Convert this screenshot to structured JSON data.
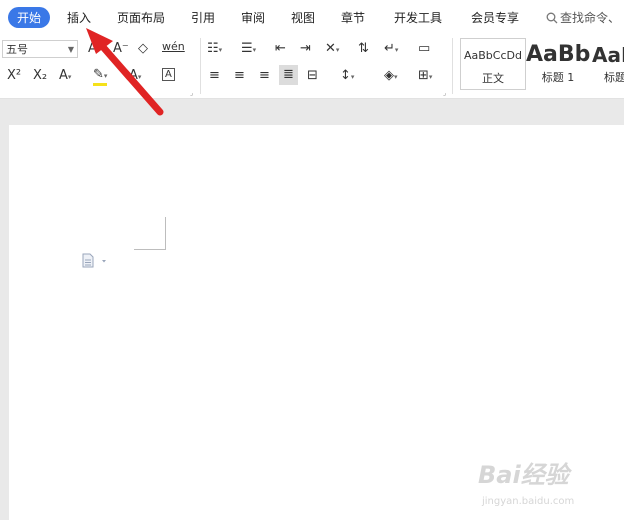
{
  "tabs": [
    {
      "label": "开始",
      "active": true
    },
    {
      "label": "插入"
    },
    {
      "label": "页面布局"
    },
    {
      "label": "引用"
    },
    {
      "label": "审阅"
    },
    {
      "label": "视图"
    },
    {
      "label": "章节"
    },
    {
      "label": "开发工具"
    },
    {
      "label": "会员专享"
    }
  ],
  "search": {
    "label": "查找命令、"
  },
  "ribbon": {
    "font_size": "五号",
    "grow_font": "A⁺",
    "shrink_font": "A⁻",
    "clear_format": "◇",
    "pinyin": "wén",
    "superscript": "X²",
    "subscript": "X₂",
    "text_effect": "A",
    "highlight": "✎",
    "font_color": "A",
    "char_border": "A"
  },
  "styles": [
    {
      "sample": "AaBbCcDd",
      "name": "正文"
    },
    {
      "sample": "AaBb",
      "name": "标题 1"
    },
    {
      "sample": "AaB",
      "name": "标题"
    }
  ],
  "watermark": {
    "text": "Bai经验",
    "url": "jingyan.baidu.com"
  },
  "colors": {
    "accent": "#3a78e7",
    "arrow": "#e02424"
  }
}
